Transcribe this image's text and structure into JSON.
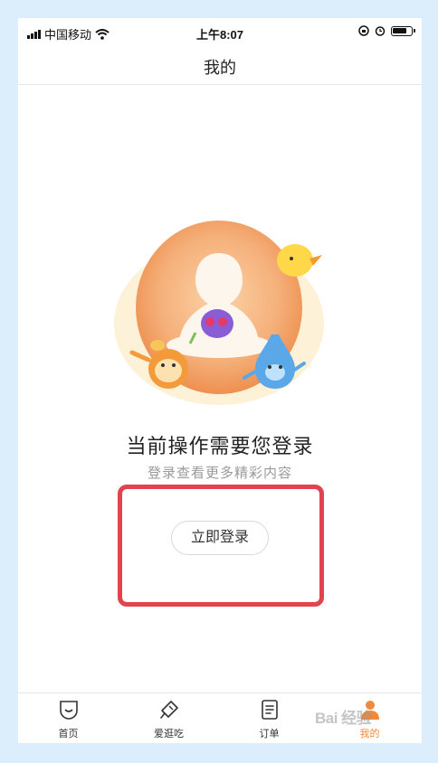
{
  "status_bar": {
    "carrier": "中国移动",
    "time": "上午8:07"
  },
  "nav": {
    "title": "我的"
  },
  "content": {
    "main_message": "当前操作需要您登录",
    "sub_message": "登录查看更多精彩内容",
    "login_button_label": "立即登录"
  },
  "tab_bar": {
    "items": [
      {
        "label": "首页",
        "icon": "home-icon"
      },
      {
        "label": "爱逛吃",
        "icon": "ice-cream-icon"
      },
      {
        "label": "订单",
        "icon": "order-list-icon"
      },
      {
        "label": "我的",
        "icon": "profile-icon",
        "active": true
      }
    ]
  },
  "watermark": "Bai 经验",
  "colors": {
    "accent_orange": "#f08a3c",
    "highlight_red": "#e2444e",
    "page_background": "#dcedfb"
  }
}
